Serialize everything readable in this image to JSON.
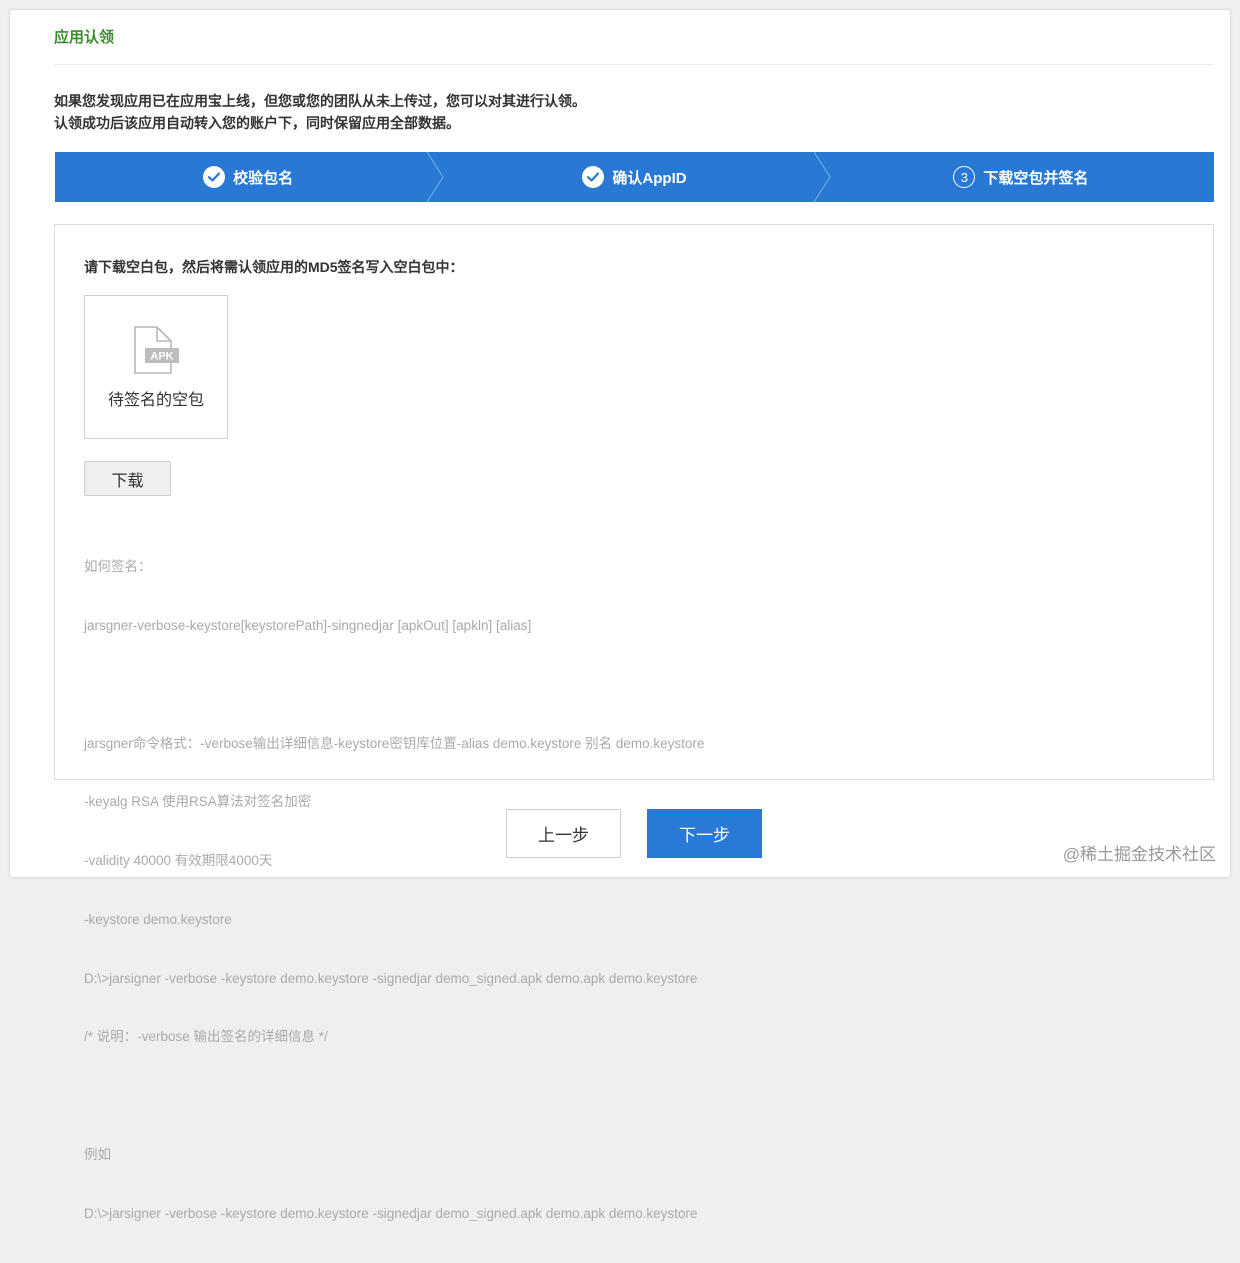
{
  "page": {
    "title": "应用认领",
    "intro_lines": [
      "如果您发现应用已在应用宝上线，但您或您的团队从未上传过，您可以对其进行认领。",
      "认领成功后该应用自动转入您的账户下，同时保留应用全部数据。"
    ]
  },
  "steps": [
    {
      "label": "校验包名",
      "status": "done",
      "icon": "check-circle-icon"
    },
    {
      "label": "确认AppID",
      "status": "done",
      "icon": "check-circle-icon"
    },
    {
      "label": "下载空包并签名",
      "status": "current",
      "number": "3"
    }
  ],
  "panel": {
    "heading": "请下载空白包，然后将需认领应用的MD5签名写入空白包中：",
    "apk_badge": "APK",
    "apk_label": "待签名的空包",
    "download_label": "下载",
    "help_lines": [
      "如何签名：",
      "jarsgner-verbose-keystore[keystorePath]-singnedjar [apkOut] [apkln] [alias]",
      "",
      "jarsgner命令格式：-verbose输出详细信息-keystore密钥库位置-alias demo.keystore 别名 demo.keystore",
      "-keyalg RSA 使用RSA算法对签名加密",
      "-validity 40000 有效期限4000天",
      "-keystore demo.keystore",
      "D:\\>jarsigner -verbose -keystore demo.keystore -signedjar demo_signed.apk demo.apk demo.keystore",
      "/* 说明：-verbose 输出签名的详细信息 */",
      "",
      "例如",
      "D:\\>jarsigner -verbose -keystore demo.keystore -signedjar demo_signed.apk demo.apk demo.keystore"
    ]
  },
  "footer": {
    "prev_label": "上一步",
    "next_label": "下一步"
  },
  "watermark": "@稀土掘金技术社区",
  "colors": {
    "accent": "#2978d4",
    "title_green": "#3a8f2c",
    "help_gray": "#aaaaaa"
  }
}
